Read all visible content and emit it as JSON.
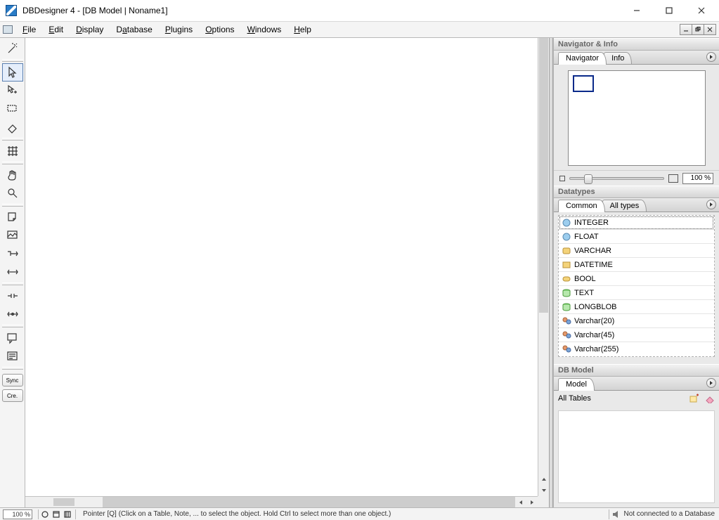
{
  "titlebar": {
    "text": "DBDesigner 4 - [DB Model | Noname1]"
  },
  "menu": {
    "file": "File",
    "edit": "Edit",
    "display": "Display",
    "database": "Database",
    "plugins": "Plugins",
    "options": "Options",
    "windows": "Windows",
    "help": "Help"
  },
  "panels": {
    "navigator_title": "Navigator & Info",
    "navigator_tab": "Navigator",
    "info_tab": "Info",
    "zoom_value": "100 %",
    "datatypes_title": "Datatypes",
    "dt_common_tab": "Common",
    "dt_all_tab": "All types",
    "dbmodel_title": "DB Model",
    "model_tab": "Model",
    "all_tables": "All Tables"
  },
  "datatypes": {
    "i0": "INTEGER",
    "i1": "FLOAT",
    "i2": "VARCHAR",
    "i3": "DATETIME",
    "i4": "BOOL",
    "i5": "TEXT",
    "i6": "LONGBLOB",
    "i7": "Varchar(20)",
    "i8": "Varchar(45)",
    "i9": "Varchar(255)"
  },
  "toolbuttons": {
    "sync": "Sync",
    "create": "Cre."
  },
  "status": {
    "zoom": "100 %",
    "hint": "Pointer [Q] (Click on a Table, Note, ... to select the object. Hold Ctrl to select more than one object.)",
    "conn": "Not connected to a Database"
  }
}
